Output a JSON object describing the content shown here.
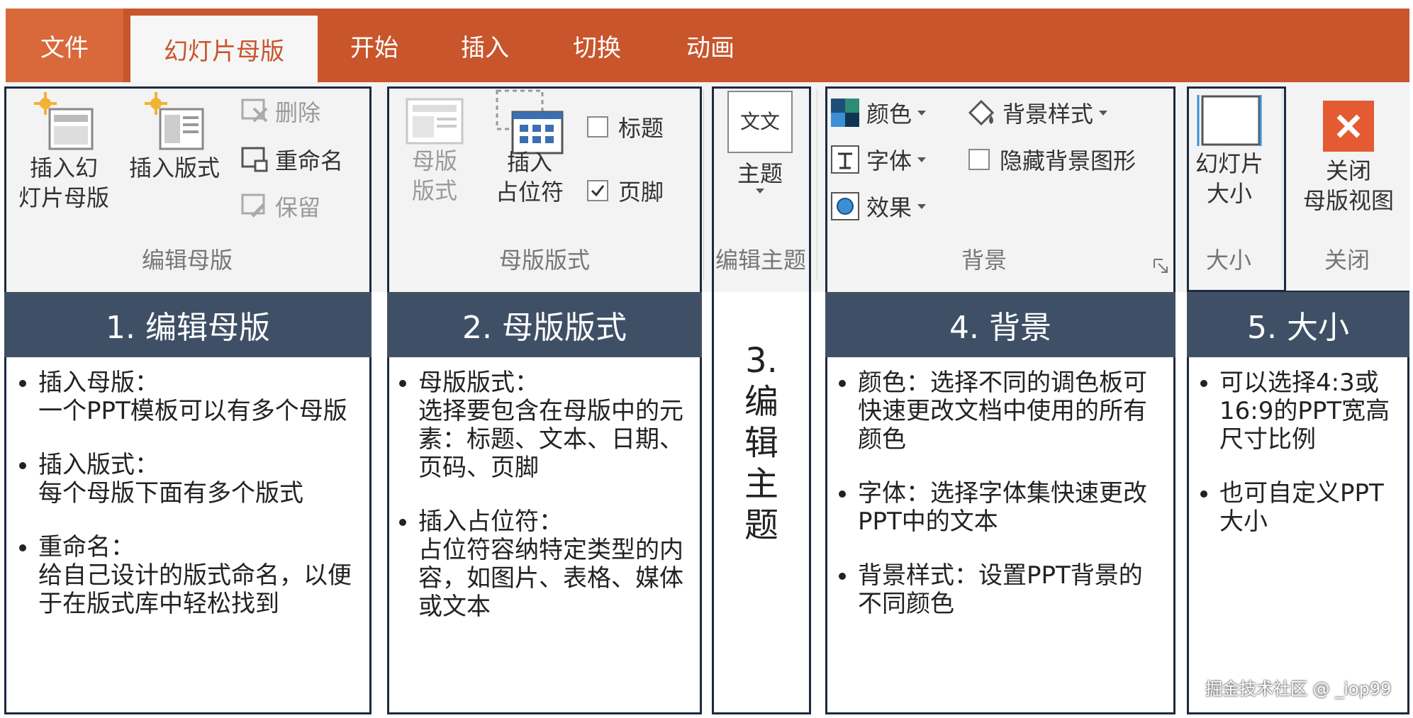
{
  "tabs": [
    "文件",
    "幻灯片母版",
    "开始",
    "插入",
    "切换",
    "动画"
  ],
  "ribbon": {
    "edit_master": {
      "insert_master": "插入幻\n灯片母版",
      "insert_layout": "插入版式",
      "delete": "删除",
      "rename": "重命名",
      "preserve": "保留",
      "label": "编辑母版"
    },
    "master_layout": {
      "master_layout_btn": "母版\n版式",
      "insert_placeholder": "插入\n占位符",
      "title_check": "标题",
      "footer_check": "页脚",
      "label": "母版版式"
    },
    "edit_theme": {
      "themes": "主题",
      "theme_icon_text": "文文",
      "label": "编辑主题"
    },
    "background": {
      "colors": "颜色",
      "fonts": "字体",
      "effects": "效果",
      "bg_styles": "背景样式",
      "hide_bg": "隐藏背景图形",
      "label": "背景"
    },
    "size": {
      "slide_size": "幻灯片\n大小",
      "label": "大小"
    },
    "close": {
      "close_master": "关闭\n母版视图",
      "label": "关闭"
    }
  },
  "sections": {
    "s1": {
      "title": "1. 编辑母版",
      "items": [
        {
          "head": "插入母版：",
          "body": "一个PPT模板可以有多个母版"
        },
        {
          "head": "插入版式：",
          "body": "每个母版下面有多个版式"
        },
        {
          "head": "重命名：",
          "body": "给自己设计的版式命名，以便于在版式库中轻松找到"
        }
      ]
    },
    "s2": {
      "title": "2. 母版版式",
      "items": [
        {
          "head": "母版版式：",
          "body": "选择要包含在母版中的元素：标题、文本、日期、页码、页脚"
        },
        {
          "head": "插入占位符：",
          "body": "占位符容纳特定类型的内容，如图片、表格、媒体或文本"
        }
      ]
    },
    "s3": {
      "title": "3.\n编\n辑\n主\n题"
    },
    "s4": {
      "title": "4. 背景",
      "items": [
        {
          "head": "颜色：选择不同的调色板可快速更改文档中使用的所有颜色"
        },
        {
          "head": "字体：选择字体集快速更改PPT中的文本"
        },
        {
          "head": "背景样式：设置PPT背景的不同颜色"
        }
      ]
    },
    "s5": {
      "title": "5. 大小",
      "items": [
        {
          "head": "可以选择4:3或16:9的PPT宽高尺寸比例"
        },
        {
          "head": "也可自定义PPT大小"
        }
      ]
    }
  },
  "watermark": "掘金技术社区 @ _iop99",
  "colors": {
    "tabbar": "#c9552c",
    "header": "#3f5066",
    "frame": "#1c2a40",
    "close_red": "#e45a32"
  }
}
